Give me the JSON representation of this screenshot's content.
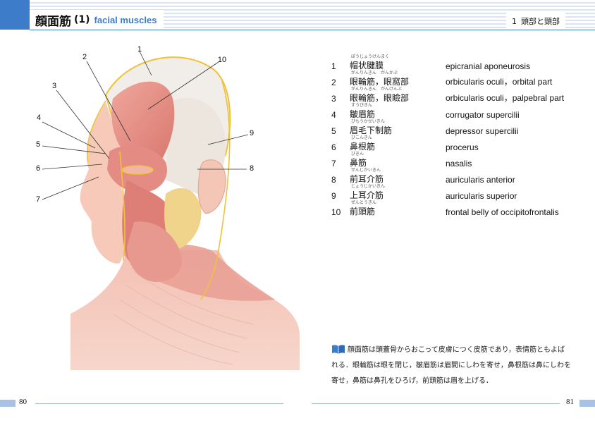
{
  "header": {
    "title_jp": "顔面筋",
    "title_num": "(1)",
    "title_en": "facial muscles",
    "section_num": "1",
    "section_label": "頭部と頸部"
  },
  "illustration": {
    "callouts": [
      "1",
      "2",
      "3",
      "4",
      "5",
      "6",
      "7",
      "8",
      "9",
      "10"
    ]
  },
  "legend": [
    {
      "num": "1",
      "ruby": "ぼうじょうけんまく",
      "jp": "帽状腱膜",
      "en": "epicranial aponeurosis"
    },
    {
      "num": "2",
      "ruby": "がんりんきん　がんかぶ",
      "jp": "眼輪筋，眼窩部",
      "en": "orbicularis oculi，orbital part"
    },
    {
      "num": "3",
      "ruby": "がんりんきん　がんけんぶ",
      "jp": "眼輪筋，眼瞼部",
      "en": "orbicularis oculi，palpebral part"
    },
    {
      "num": "4",
      "ruby": "すうびきん",
      "jp": "皺眉筋",
      "en": "corrugator supercilii"
    },
    {
      "num": "5",
      "ruby": "びもうかせいきん",
      "jp": "眉毛下制筋",
      "en": "depressor supercilii"
    },
    {
      "num": "6",
      "ruby": "びこんきん",
      "jp": "鼻根筋",
      "en": "procerus"
    },
    {
      "num": "7",
      "ruby": "びきん",
      "jp": "鼻筋",
      "en": "nasalis"
    },
    {
      "num": "8",
      "ruby": "ぜんじかいきん",
      "jp": "前耳介筋",
      "en": "auricularis anterior"
    },
    {
      "num": "9",
      "ruby": "じょうじかいきん",
      "jp": "上耳介筋",
      "en": "auricularis superior"
    },
    {
      "num": "10",
      "ruby": "ぜんとうきん",
      "jp": "前頭筋",
      "en": "frontal belly of occipitofrontalis"
    }
  ],
  "note": {
    "icon": "open-book-icon",
    "text": "顔面筋は頭蓋骨からおこって皮膚につく皮筋であり，表情筋ともよばれる．眼輪筋は眼を閉じ，皺眉筋は眉間にしわを寄せ，鼻根筋は鼻にしわを寄せ，鼻筋は鼻孔をひろげ，前頭筋は眉を上げる．"
  },
  "footer": {
    "page_left": "80",
    "page_right": "81"
  },
  "colors": {
    "accent": "#3d7cc9",
    "stripe": "#dbe4f2",
    "footer_bar": "#a8c2e6",
    "muscle": "#e48c84",
    "skin": "#f6c9b8",
    "aponeurosis": "#f1ede8",
    "fascia_line": "#efc23a",
    "gland": "#f0d48c"
  }
}
